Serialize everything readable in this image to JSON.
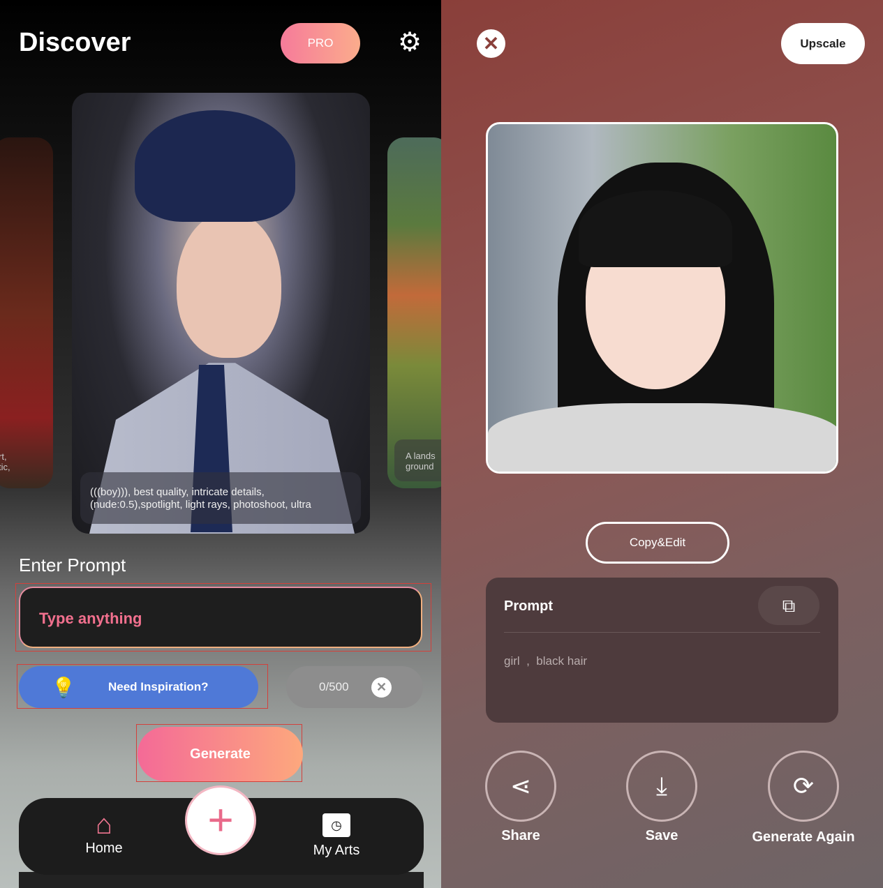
{
  "discover": {
    "title": "Discover",
    "pro_label": "PRO",
    "settings_icon": "gear-icon",
    "carousel": {
      "main_caption": "(((boy))), best quality, intricate details, (nude:0.5),spotlight, light rays, photoshoot, ultra",
      "left_caption": "rt,\ntic,",
      "right_caption": "A lands\nground"
    },
    "enter_prompt_label": "Enter Prompt",
    "prompt_placeholder": "Type anything",
    "inspiration_label": "Need Inspiration?",
    "char_count": "0/500",
    "generate_label": "Generate",
    "nav": {
      "home": "Home",
      "my_arts": "My Arts"
    }
  },
  "result": {
    "upscale_label": "Upscale",
    "copy_edit_label": "Copy&Edit",
    "prompt_title": "Prompt",
    "prompt_text": "girl  ,  black hair",
    "actions": {
      "share": "Share",
      "save": "Save",
      "generate_again": "Generate Again"
    }
  },
  "colors": {
    "accent_pink": "#f46a97",
    "accent_orange": "#fda87d",
    "inspiration_blue": "#4f79d7"
  }
}
